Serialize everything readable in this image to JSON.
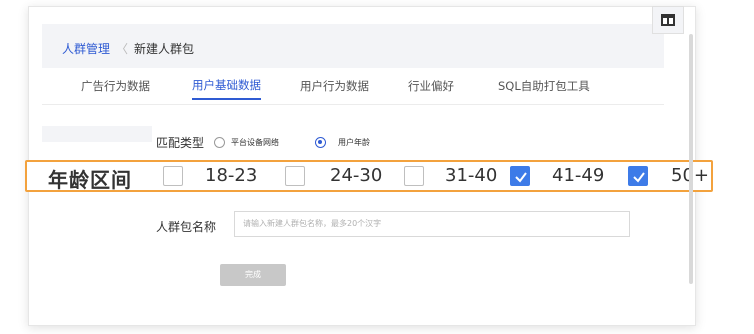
{
  "breadcrumb": {
    "root": "人群管理",
    "separator": "〈",
    "current": "新建人群包"
  },
  "tabs": [
    {
      "label": "广告行为数据",
      "active": false
    },
    {
      "label": "用户基础数据",
      "active": true
    },
    {
      "label": "用户行为数据",
      "active": false
    },
    {
      "label": "行业偏好",
      "active": false
    },
    {
      "label": "SQL自助打包工具",
      "active": false
    }
  ],
  "match_type": {
    "label": "匹配类型",
    "options": [
      {
        "label": "平台设备网络",
        "selected": false
      },
      {
        "label": "用户年龄",
        "selected": true
      }
    ]
  },
  "age_range": {
    "label": "年龄区间",
    "options": [
      {
        "label": "18-23",
        "checked": false
      },
      {
        "label": "24-30",
        "checked": false
      },
      {
        "label": "31-40",
        "checked": false
      },
      {
        "label": "41-49",
        "checked": true
      },
      {
        "label": "50+",
        "checked": true
      }
    ]
  },
  "package_name": {
    "label": "人群包名称",
    "placeholder": "请输入新建人群包名称，最多20个汉字"
  },
  "done_button": "完成",
  "colors": {
    "accent": "#2f5bd3",
    "checkbox_checked": "#3d7be8",
    "highlight_border": "#f3a23d"
  }
}
